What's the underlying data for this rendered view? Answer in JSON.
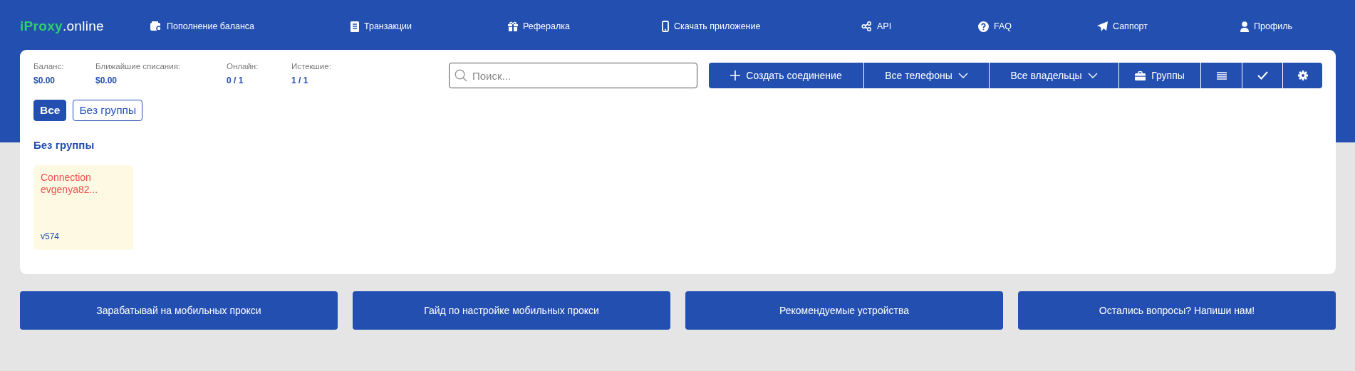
{
  "logo": {
    "brand": "iProxy",
    "domain": ".online"
  },
  "nav": [
    {
      "label": "Пополнение баланса",
      "kind": "wallet"
    },
    {
      "label": "Транзакции",
      "kind": "receipt"
    },
    {
      "label": "Рефералка",
      "kind": "gift"
    },
    {
      "label": "Скачать приложение",
      "kind": "phone"
    },
    {
      "label": "API",
      "kind": "nodes"
    },
    {
      "label": "FAQ",
      "kind": "help"
    },
    {
      "label": "Саппорт",
      "kind": "send"
    },
    {
      "label": "Профиль",
      "kind": "user"
    }
  ],
  "stats": [
    {
      "label": "Баланс:",
      "value": "$0.00"
    },
    {
      "label": "Ближайшие списания:",
      "value": "$0.00"
    },
    {
      "label": "Онлайн:",
      "value": "0 / 1"
    },
    {
      "label": "Истекшие:",
      "value": "1 / 1"
    }
  ],
  "search": {
    "placeholder": "Поиск..."
  },
  "toolbar": [
    {
      "kind": "create",
      "label": "Создать соединение"
    },
    {
      "kind": "dropdown",
      "label": "Все телефоны"
    },
    {
      "kind": "dropdown",
      "label": "Все владельцы"
    },
    {
      "kind": "groups",
      "label": "Группы"
    },
    {
      "kind": "list"
    },
    {
      "kind": "check"
    },
    {
      "kind": "settings"
    }
  ],
  "filters": [
    {
      "label": "Все",
      "selected": true
    },
    {
      "label": "Без группы",
      "selected": false
    }
  ],
  "group": {
    "title": "Без группы",
    "connections": [
      {
        "name": "Connection evgenya82...",
        "version": "v574"
      }
    ]
  },
  "links": [
    "Зарабатывай на мобильных прокси",
    "Гайд по настройке мобильных прокси",
    "Рекомендуемые устройства",
    "Остались вопросы? Напиши нам!"
  ]
}
